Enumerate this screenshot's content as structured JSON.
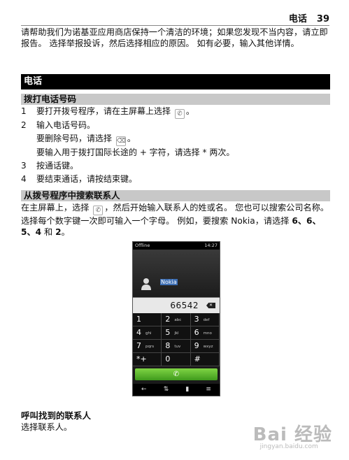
{
  "header": {
    "section": "电话",
    "page": "39"
  },
  "intro": "请帮助我们为诺基亚应用商店保持一个清洁的环境；如果您发现不当内容，请立即报告。 选择举报投诉，然后选择相应的原因。 如有必要，输入其他详情。",
  "section_title": "电话",
  "sub1": "拨打电话号码",
  "steps": [
    {
      "n": "1",
      "text": "要打开拨号程序，请在主屏幕上选择",
      "after": "。"
    },
    {
      "n": "2",
      "text": "输入电话号码。"
    },
    {
      "n": "",
      "text": "要删除号码，请选择",
      "after": "。"
    },
    {
      "n": "",
      "text": "要输入用于拨打国际长途的 + 字符，请选择 * 两次。"
    },
    {
      "n": "3",
      "text": "按通话键。"
    },
    {
      "n": "4",
      "text": "要结束通话，请按结束键。"
    }
  ],
  "sub2": "从拨号程序中搜索联系人",
  "para2_a": "在主屏幕上，选择",
  "para2_b": "，然后开始输入联系人的姓或名。 您也可以搜索公司名称。 选择每个数字键一次即可输入一个字母。 例如，要搜索 Nokia，请选择",
  "para2_keys": "6、6、5、4",
  "para2_and": "和",
  "para2_last": "2",
  "para2_end": "。",
  "phone": {
    "status_left": "Offline",
    "status_right": "14:27",
    "contact": "Nokia",
    "number": "66542",
    "keys": [
      {
        "d": "1",
        "l": ""
      },
      {
        "d": "2",
        "l": "abc"
      },
      {
        "d": "3",
        "l": "def"
      },
      {
        "d": "4",
        "l": "ghi"
      },
      {
        "d": "5",
        "l": "jkl"
      },
      {
        "d": "6",
        "l": "mno"
      },
      {
        "d": "7",
        "l": "pqrs"
      },
      {
        "d": "8",
        "l": "tuv"
      },
      {
        "d": "9",
        "l": "wxyz"
      },
      {
        "d": "*+",
        "l": ""
      },
      {
        "d": "0",
        "l": ""
      },
      {
        "d": "#",
        "l": ""
      }
    ]
  },
  "call_title": "呼叫找到的联系人",
  "call_desc": "选择联系人。",
  "watermark": {
    "brand": "Bai 经验",
    "url": "jingyan.baidu.com"
  }
}
